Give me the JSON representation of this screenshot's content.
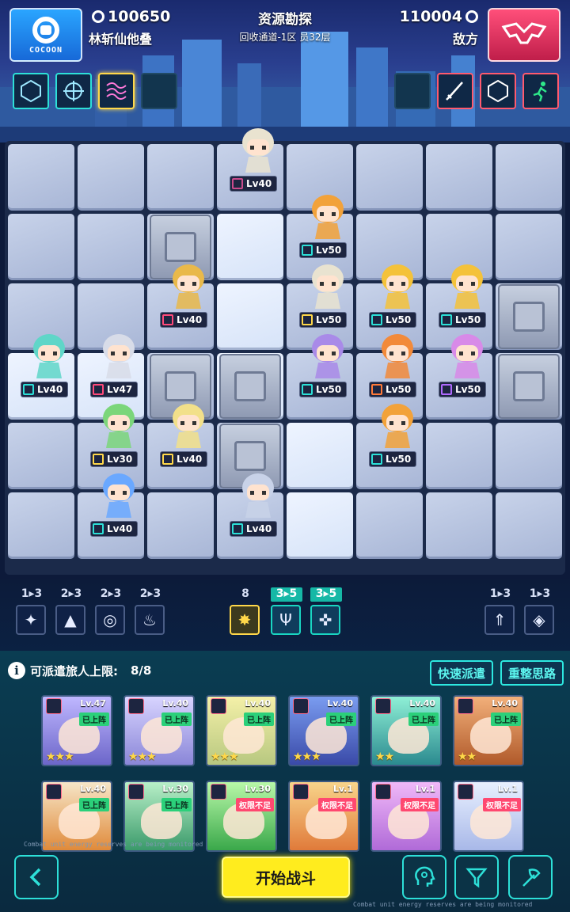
{
  "header": {
    "self_brand": "COCOON",
    "self_score": "100650",
    "self_name": "林斩仙他叠",
    "mode_title": "资源勘探",
    "mode_subtitle": "回收通道-1区  员32层",
    "enemy_score": "110004",
    "enemy_name": "敌方"
  },
  "board_units": [
    {
      "level": "Lv40"
    },
    {
      "level": "Lv50"
    },
    {
      "level": "Lv40"
    },
    {
      "level": "Lv50"
    },
    {
      "level": "Lv50"
    },
    {
      "level": "Lv50"
    },
    {
      "level": "Lv40"
    },
    {
      "level": "Lv47"
    },
    {
      "level": "Lv50"
    },
    {
      "level": "Lv50"
    },
    {
      "level": "Lv50"
    },
    {
      "level": "Lv30"
    },
    {
      "level": "Lv40"
    },
    {
      "level": "Lv50"
    },
    {
      "level": "Lv40"
    },
    {
      "level": "Lv40"
    }
  ],
  "synergy": [
    {
      "count": "1▸3",
      "icon": "shuriken-icon"
    },
    {
      "count": "2▸3",
      "icon": "mountain-icon"
    },
    {
      "count": "2▸3",
      "icon": "swirl-icon"
    },
    {
      "count": "2▸3",
      "icon": "flame-icon"
    },
    {
      "count": "8",
      "icon": "star-burst-icon"
    },
    {
      "count": "3▸5",
      "icon": "trident-icon"
    },
    {
      "count": "3▸5",
      "icon": "crosshair-icon"
    },
    {
      "count": "1▸3",
      "icon": "arrowhead-icon"
    },
    {
      "count": "1▸3",
      "icon": "diamond-emblem-icon"
    }
  ],
  "roster": {
    "limit_label": "可派遣旅人上限:",
    "limit_value": "8/8",
    "quick_button": "快速派遣",
    "reset_button": "重整思路",
    "cards": [
      {
        "level": "Lv.47",
        "status": "已上阵",
        "stars": "★★★"
      },
      {
        "level": "Lv.40",
        "status": "已上阵",
        "stars": "★★★"
      },
      {
        "level": "Lv.40",
        "status": "已上阵",
        "stars": "★★★"
      },
      {
        "level": "Lv.40",
        "status": "已上阵",
        "stars": "★★★"
      },
      {
        "level": "Lv.40",
        "status": "已上阵",
        "stars": "★★"
      },
      {
        "level": "Lv.40",
        "status": "已上阵",
        "stars": "★★"
      },
      {
        "level": "Lv.40",
        "status": "已上阵",
        "stars": ""
      },
      {
        "level": "Lv.30",
        "status": "已上阵",
        "stars": ""
      },
      {
        "level": "Lv.30",
        "status": "权限不足",
        "stars": ""
      },
      {
        "level": "Lv.1",
        "status": "权限不足",
        "stars": ""
      },
      {
        "level": "Lv.1",
        "status": "权限不足",
        "stars": ""
      },
      {
        "level": "Lv.1",
        "status": "权限不足",
        "stars": ""
      }
    ]
  },
  "footer": {
    "start_button": "开始战斗",
    "monitor_text": "Combat unit energy reserves are being monitored"
  },
  "colors": {
    "accent_cyan": "#2de0d8",
    "start_yellow": "#ffec1e",
    "deployed_green": "#2bd07a",
    "locked_red": "#ff4870"
  }
}
